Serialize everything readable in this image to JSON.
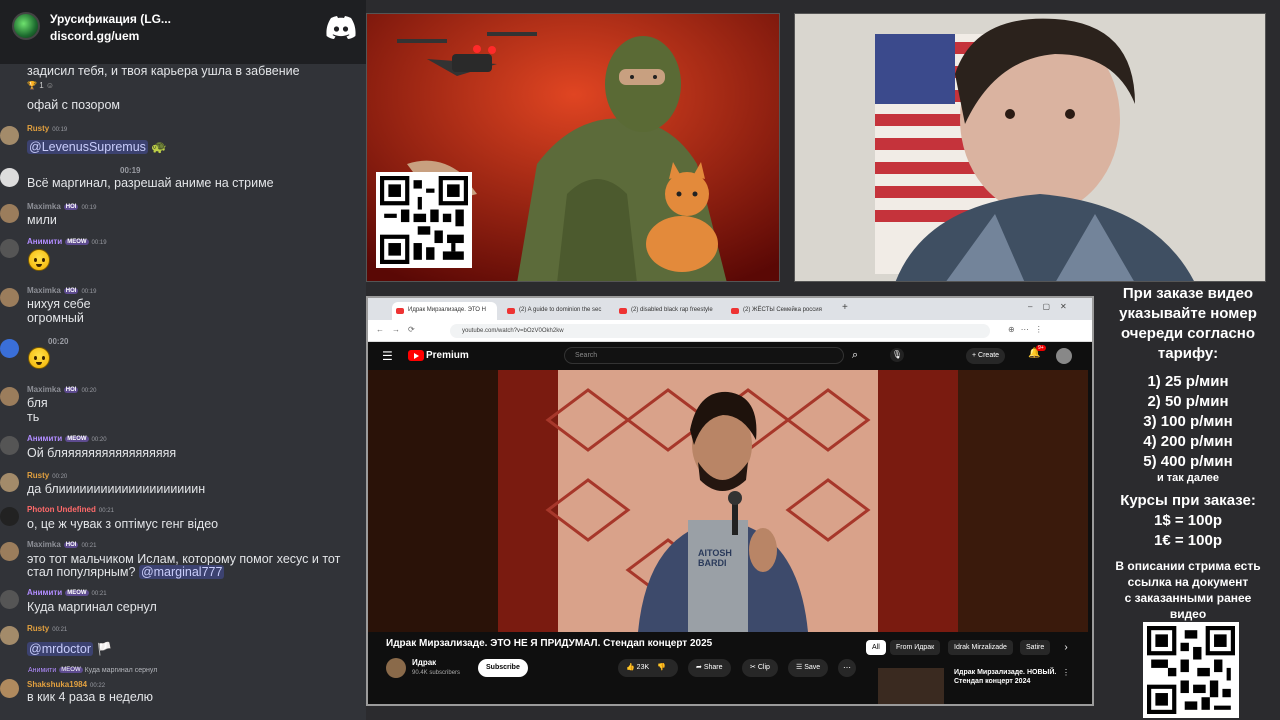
{
  "server": {
    "name": "Урусификация (LG...",
    "link": "discord.gg/uem"
  },
  "chat": [
    {
      "type": "text",
      "text": "задисил тебя, и твоя карьера ушла в забвение"
    },
    {
      "type": "reaction",
      "emoji": "🏆",
      "count": "1"
    },
    {
      "type": "text",
      "text": "офай с позором"
    },
    {
      "user": "Rusty",
      "time": "00:19",
      "mention": "@LevenusSupremus"
    },
    {
      "time": "00:19",
      "text": "Всё маргинал, разрешай аниме на стриме"
    },
    {
      "user": "Maximka",
      "badge": "HOI",
      "time": "00:19",
      "text": "мили"
    },
    {
      "user": "Анимити",
      "badge": "MEOW",
      "time": "00:19"
    },
    {
      "user": "Maximka",
      "badge": "HOI",
      "time": "00:19",
      "text": "нихуя себе",
      "text2": "огромный"
    },
    {
      "time": "00:20"
    },
    {
      "user": "Maximka",
      "badge": "HOI",
      "time": "00:20",
      "text": "бля",
      "text2": "ть"
    },
    {
      "user": "Анимити",
      "badge": "MEOW",
      "time": "00:20",
      "text": "Ой бляяяяяяяяяяяяяяяяя"
    },
    {
      "user": "Rusty",
      "time": "00:20",
      "text": "да блиииииииииииииииииииин"
    },
    {
      "user": "Photon Undefined",
      "time": "00:21",
      "text": "о, це ж чувак з оптімус генг відео"
    },
    {
      "user": "Maximka",
      "badge": "HOI",
      "time": "00:21",
      "text": "это тот мальчиком Ислам, которому помог хесус и тот",
      "text2": "стал популярным?",
      "mention": "@marginal777"
    },
    {
      "user": "Анимити",
      "badge": "MEOW",
      "time": "00:21",
      "text": "Куда маргинал сернул"
    },
    {
      "user": "Rusty",
      "time": "00:21",
      "mention": "@mrdoctor"
    },
    {
      "reply_user": "Анимити",
      "reply_badge": "MEOW",
      "reply": "Куда маргинал сернул",
      "user": "Shakshuka1984",
      "time": "00:22",
      "text": "в кик 4 раза в неделю"
    }
  ],
  "browser": {
    "tabs": [
      "Идрак Мирзализаде. ЭТО Н",
      "(2) A guide to dominion the sec",
      "(2) disabled black rap freestyle",
      "(2) ЖЁСТЫ Семейка россия"
    ],
    "url": "youtube.com/watch?v=bOzV0Okh2kw"
  },
  "youtube": {
    "brand": "Premium",
    "search_placeholder": "Search",
    "create": "Create",
    "notif": "9+",
    "title": "Идрак Мирзализаде. ЭТО НЕ Я ПРИДУМАЛ. Стендап концерт 2025",
    "channel": "Идрак",
    "subs": "90.4K subscribers",
    "subscribe": "Subscribe",
    "likes": "23K",
    "share": "Share",
    "clip": "Clip",
    "save": "Save",
    "chips": [
      "All",
      "From Идрак",
      "Idrak Mirzalizade",
      "Satire"
    ],
    "rec_title_1": "Идрак Мирзализаде. НОВЫЙ.",
    "rec_title_2": "Стендап концерт 2024",
    "shirt": [
      "AITOSH",
      "BARDI"
    ]
  },
  "info": {
    "head": [
      "При заказе видео",
      "указывайте номер",
      "очереди согласно",
      "тарифу:"
    ],
    "tariffs": [
      "1) 25 р/мин",
      "2) 50 р/мин",
      "3) 100 р/мин",
      "4) 200 р/мин",
      "5) 400 р/мин"
    ],
    "etc": "и так далее",
    "courses_head": "Курсы при заказе:",
    "courses": [
      "1$ = 100р",
      "1€ = 100р"
    ],
    "desc": [
      "В описании стрима есть",
      "ссылка на документ",
      "с заказанными ранее",
      "видео"
    ]
  },
  "colors": {
    "mention_bg": "#3c4270",
    "name_orange": "#e2a03f",
    "name_gray": "#8d8f96",
    "name_purple": "#b18cff",
    "name_red": "#ff6a6a"
  }
}
